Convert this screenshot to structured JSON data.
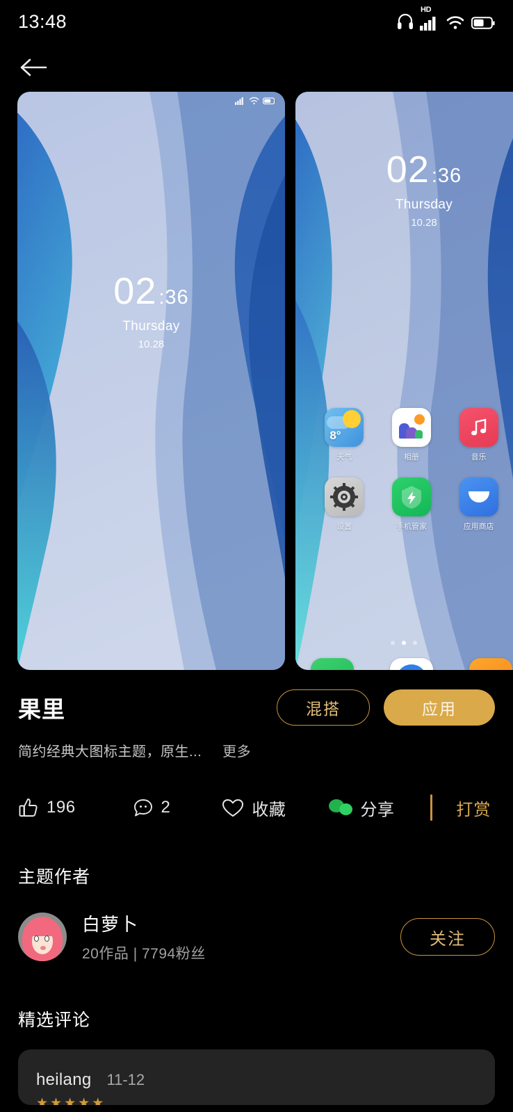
{
  "status_bar": {
    "time": "13:48",
    "icons": [
      "headphone-icon",
      "hd-label",
      "signal-icon",
      "wifi-icon",
      "battery-icon"
    ],
    "hd_label": "HD"
  },
  "nav": {
    "back_icon": "back-arrow-icon"
  },
  "previews": {
    "lock": {
      "hour": "02",
      "minute": ":36",
      "weekday": "Thursday",
      "date": "10.28"
    },
    "home": {
      "hour": "02",
      "minute": ":36",
      "weekday": "Thursday",
      "date": "10.28",
      "apps": [
        {
          "label": "天气",
          "icon": "weather-icon",
          "temp": "8°"
        },
        {
          "label": "相册",
          "icon": "album-icon"
        },
        {
          "label": "音乐",
          "icon": "music-icon"
        },
        {
          "label": "设置",
          "icon": "settings-icon"
        },
        {
          "label": "手机管家",
          "icon": "phone-manager-icon"
        },
        {
          "label": "应用商店",
          "icon": "app-store-icon"
        }
      ],
      "dock": [
        {
          "icon": "phone-icon"
        },
        {
          "icon": "camera-icon"
        },
        {
          "icon": "messages-icon"
        }
      ],
      "search_icon": "search-icon",
      "page_dots": 3,
      "active_dot": 1
    }
  },
  "theme": {
    "title": "果里",
    "mix_button": "混搭",
    "apply_button": "应用",
    "description": "简约经典大图标主题，原生...",
    "more_link": "更多"
  },
  "actions": {
    "like_count": "196",
    "like_icon": "thumbs-up-icon",
    "comment_count": "2",
    "comment_icon": "comment-icon",
    "favorite_label": "收藏",
    "favorite_icon": "heart-icon",
    "share_label": "分享",
    "share_icon": "wechat-icon",
    "reward_label": "打赏"
  },
  "author_section": {
    "heading": "主题作者",
    "name": "白萝卜",
    "meta": "20作品 | 7794粉丝",
    "follow_button": "关注",
    "avatar_icon": "avatar"
  },
  "comments_section": {
    "heading": "精选评论",
    "comments": [
      {
        "user": "heilang",
        "date": "11-12",
        "rating": 5
      }
    ]
  },
  "colors": {
    "accent_gold": "#d9a94a",
    "outline_gold": "#c9953c",
    "background": "#000000",
    "card_background": "#242424",
    "wechat_green": "#22b14c"
  }
}
